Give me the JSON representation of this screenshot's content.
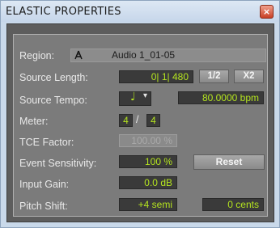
{
  "window": {
    "title": "ELASTIC PROPERTIES",
    "close_glyph": "×"
  },
  "region": {
    "label": "Region:",
    "icon": "audio-clip-icon",
    "value": "Audio 1_01-05"
  },
  "source_length": {
    "label": "Source Length:",
    "value": "0| 1| 480",
    "half_button": "1/2",
    "double_button": "X2"
  },
  "source_tempo": {
    "label": "Source Tempo:",
    "note_glyph": "♩",
    "dropdown_glyph": "▾",
    "value": "80.0000 bpm"
  },
  "meter": {
    "label": "Meter:",
    "numerator": "4",
    "separator": "/",
    "denominator": "4"
  },
  "tce_factor": {
    "label": "TCE Factor:",
    "value": "100.00 %"
  },
  "event_sensitivity": {
    "label": "Event Sensitivity:",
    "value": "100 %",
    "reset_button": "Reset"
  },
  "input_gain": {
    "label": "Input Gain:",
    "value": "0.0 dB"
  },
  "pitch_shift": {
    "label": "Pitch Shift:",
    "semitones": "+4 semi",
    "cents": "0 cents"
  },
  "colors": {
    "lcd_text": "#b5e51f",
    "lcd_bg": "#3a3a3a",
    "panel": "#7b7b7b"
  }
}
